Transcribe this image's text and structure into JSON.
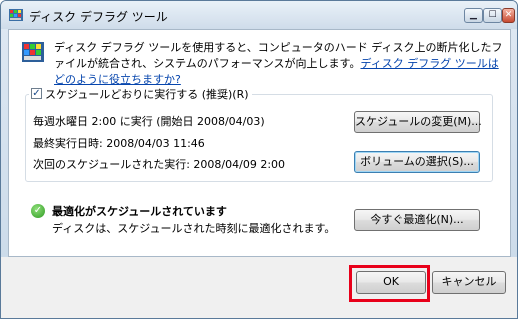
{
  "window": {
    "title": "ディスク デフラグ ツール"
  },
  "titlebar_buttons": {
    "minimize": "▁",
    "maximize": "☐",
    "close": "✕"
  },
  "intro": {
    "text": "ディスク デフラグ ツールを使用すると、コンピュータのハード ディスク上の断片化したファイルが統合され、システムのパフォーマンスが向上します。",
    "link": "ディスク デフラグ ツールはどのように役立ちますか?"
  },
  "schedule": {
    "checkbox_label": "スケジュールどおりに実行する (推奨)(R)",
    "checked": true,
    "line1": "毎週水曜日 2:00 に実行 (開始日 2008/04/03)",
    "line2": "最終実行日時: 2008/04/03 11:46",
    "line3": "次回のスケジュールされた実行: 2008/04/09 2:00",
    "modify_button": "スケジュールの変更(M)...",
    "volumes_button": "ボリュームの選択(S)..."
  },
  "status": {
    "title": "最適化がスケジュールされています",
    "description": "ディスクは、スケジュールされた時刻に最適化されます。",
    "defrag_now_button": "今すぐ最適化(N)..."
  },
  "footer": {
    "ok_button": "OK",
    "cancel_button": "キャンセル"
  },
  "colors": {
    "highlight": "#e8001a",
    "link": "#0645ad",
    "status_ok": "#2f9a23"
  },
  "icons": {
    "app": "defrag-icon",
    "status": "check-circle-icon"
  }
}
